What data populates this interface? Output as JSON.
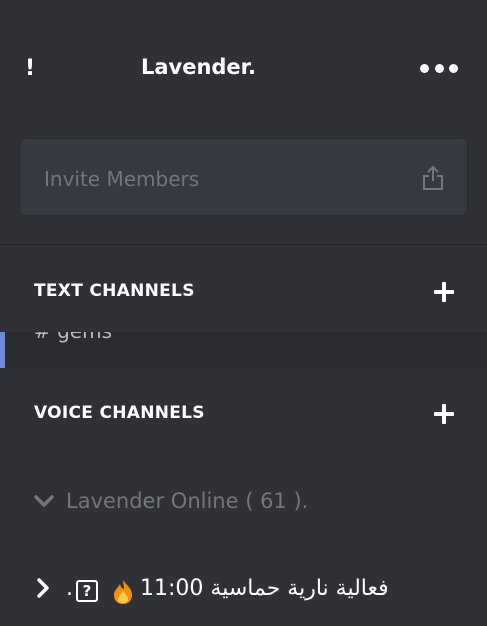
{
  "header": {
    "alert_symbol": "!",
    "server_name": "Lavender.",
    "more_icon": "ellipsis-icon"
  },
  "invite": {
    "label": "Invite Members",
    "icon": "share-icon"
  },
  "text_channels": {
    "title": "TEXT CHANNELS",
    "add_icon": "plus-icon",
    "partial_channel_name": "# gems"
  },
  "voice_channels": {
    "title": "VOICE CHANNELS",
    "add_icon": "plus-icon",
    "items": [
      {
        "label": "Lavender Online ( 61 ).",
        "icon": "chevron-down-icon"
      }
    ]
  },
  "event_channel": {
    "dot": ".",
    "qmark": "?",
    "arabic_text": "فعالية نارية حماسية",
    "time": "11:00",
    "icon": "chevron-right-icon",
    "emoji": "fire-icon"
  },
  "colors": {
    "background": "#2f3136",
    "card": "#36393f",
    "muted_text": "#72767d",
    "accent": "#7289da"
  }
}
